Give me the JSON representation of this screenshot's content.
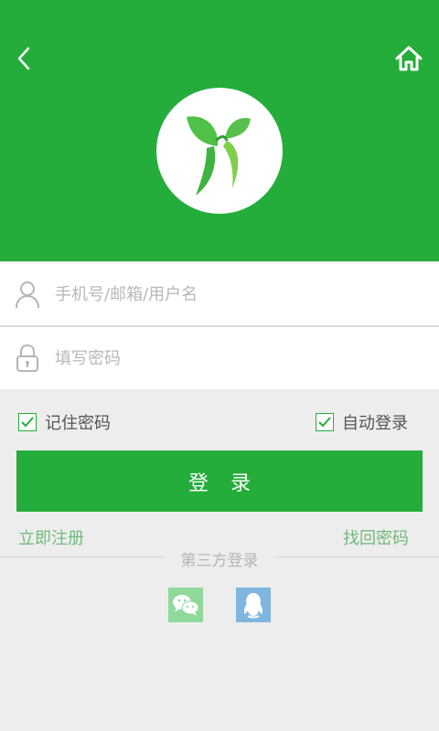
{
  "colors": {
    "brand": "#24ad3a",
    "background": "#ededed",
    "link": "#6fbb79"
  },
  "header": {
    "back_icon": "chevron-left-icon",
    "home_icon": "home-icon",
    "logo_icon": "butterfly-leaf-logo"
  },
  "form": {
    "username_placeholder": "手机号/邮箱/用户名",
    "password_placeholder": "填写密码"
  },
  "options": {
    "remember_label": "记住密码",
    "remember_checked": true,
    "auto_label": "自动登录",
    "auto_checked": true
  },
  "actions": {
    "login_label": "登录",
    "register_label": "立即注册",
    "forgot_label": "找回密码"
  },
  "third_party": {
    "label": "第三方登录",
    "providers": [
      "wechat-icon",
      "qq-icon"
    ]
  }
}
